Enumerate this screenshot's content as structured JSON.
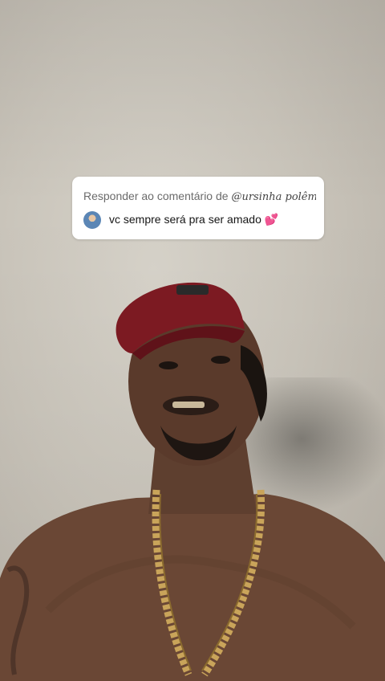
{
  "reply": {
    "prefix": "Responder ao comentário de ",
    "handle": "@ursinha polêmic...",
    "comment": "vc sempre será pra ser amado 💕"
  },
  "video": {
    "subject": "man wearing red cap and gold chain"
  },
  "icons": {
    "avatar": "commenter-avatar"
  }
}
